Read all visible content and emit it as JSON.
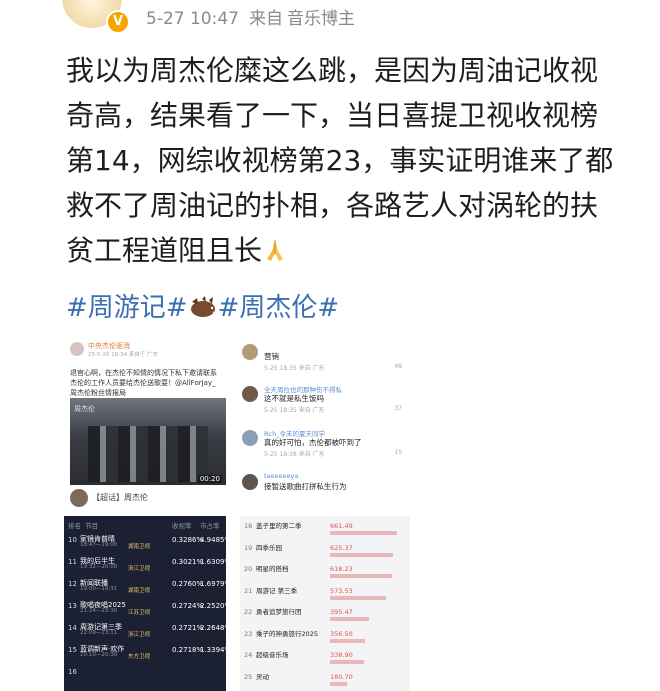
{
  "header": {
    "timestamp": "5-27 10:47",
    "via": "来自",
    "source": "音乐博主",
    "verified_badge": "V"
  },
  "post": {
    "lines": [
      "我以为周杰伦糜这么跳，是因为周油记收视",
      "奇高，结果看了一下，当日喜提卫视收视榜",
      "第14，网综收视榜第23，事实证明谁来了都",
      "救不了周油记的扑相，各路艺人对涡轮的扶",
      "贫工程道阻且长"
    ],
    "end_emoji": "folded-hands-emoji",
    "hashtag1": "#周游记#",
    "hashtag2": "#周杰伦#",
    "hashtag_icon": "boar-icon"
  },
  "images": {
    "image1": {
      "account": "中央杰伦驱消",
      "time": "25-5-26 18:34 来自于 广东",
      "text": "退官心啊，在杰伦不知情的情况下私下邀请联系杰伦的工作人员要给杰伦送歌耍！@AllForJay_周杰伦粉丝情报局",
      "overlay": "周杰伦",
      "duration": "00:20",
      "footer": "【超话】周杰伦"
    },
    "image2": {
      "comments": [
        {
          "name": "",
          "text": "营销",
          "time": "5-25 18:35 来自 广东",
          "likes": "48"
        },
        {
          "name": "全天周拉也的那种伤不得私",
          "text": "这不就是私生饭吗",
          "time": "5-25 18:35 来自 广东",
          "likes": "37"
        },
        {
          "name": "Rch_令末的夏天同学",
          "text": "真的好可怕，杰伦都被吓到了",
          "time": "5-25 18:38 来自 广东",
          "likes": "15"
        },
        {
          "name": "taeeeeeya",
          "text": "接暂送歌曲打拼私生行为",
          "time": "",
          "likes": ""
        }
      ]
    },
    "image3": {
      "headers": [
        "排名",
        "节目",
        "收视率",
        "市占率"
      ],
      "rows": [
        {
          "rank": "10",
          "title": "家镜肯普晴",
          "sub": "18:47—19:00",
          "channel": "湖南卫视",
          "rating": "0.3286%",
          "share": "4.9485%"
        },
        {
          "rank": "11",
          "title": "我的后半生",
          "sub": "19:32—20:00",
          "channel": "浙江卫视",
          "rating": "0.3021%",
          "share": "1.6309%"
        },
        {
          "rank": "12",
          "title": "新闻联播",
          "sub": "19:00—19:31",
          "channel": "湖南卫视",
          "rating": "0.2760%",
          "share": "1.6979%"
        },
        {
          "rank": "13",
          "title": "歌唱夜唱2025",
          "sub": "21:24—23:30",
          "channel": "江苏卫视",
          "rating": "0.2724%",
          "share": "2.2520%"
        },
        {
          "rank": "14",
          "title": "周游记第三季",
          "sub": "22:09—23:11",
          "channel": "浙江卫视",
          "rating": "0.2721%",
          "share": "2.2648%"
        },
        {
          "rank": "15",
          "title": "蓝调新声·欢作",
          "sub": "20:10—20:30",
          "channel": "东方卫视",
          "rating": "0.2718%",
          "share": "1.3394%"
        },
        {
          "rank": "16",
          "title": "",
          "sub": "",
          "channel": "",
          "rating": "",
          "share": ""
        }
      ]
    },
    "image4": {
      "rows": [
        {
          "rank": "18",
          "title": "盖子里的第二季",
          "sub": "",
          "value": "661.49",
          "fill": 0.48
        },
        {
          "rank": "19",
          "title": "四季乐园",
          "sub": "",
          "value": "625.37",
          "fill": 0.45
        },
        {
          "rank": "20",
          "title": "明星的搭档",
          "sub": "",
          "value": "618.23",
          "fill": 0.44
        },
        {
          "rank": "21",
          "title": "周游记 第三季",
          "sub": "",
          "value": "573.53",
          "fill": 0.4
        },
        {
          "rank": "22",
          "title": "勇者追梦旅行团",
          "sub": "",
          "value": "395.47",
          "fill": 0.28
        },
        {
          "rank": "23",
          "title": "乘子的神勇旅行2025",
          "sub": "",
          "value": "356.50",
          "fill": 0.25
        },
        {
          "rank": "24",
          "title": "超级音乐场",
          "sub": "",
          "value": "338.90",
          "fill": 0.24
        },
        {
          "rank": "25",
          "title": "灵动",
          "sub": "",
          "value": "180.70",
          "fill": 0.12
        }
      ]
    }
  },
  "colors": {
    "hashtag": "#3b6eb3",
    "meta": "#8a8a8a",
    "chart_dark_bg": "#1c2033"
  }
}
